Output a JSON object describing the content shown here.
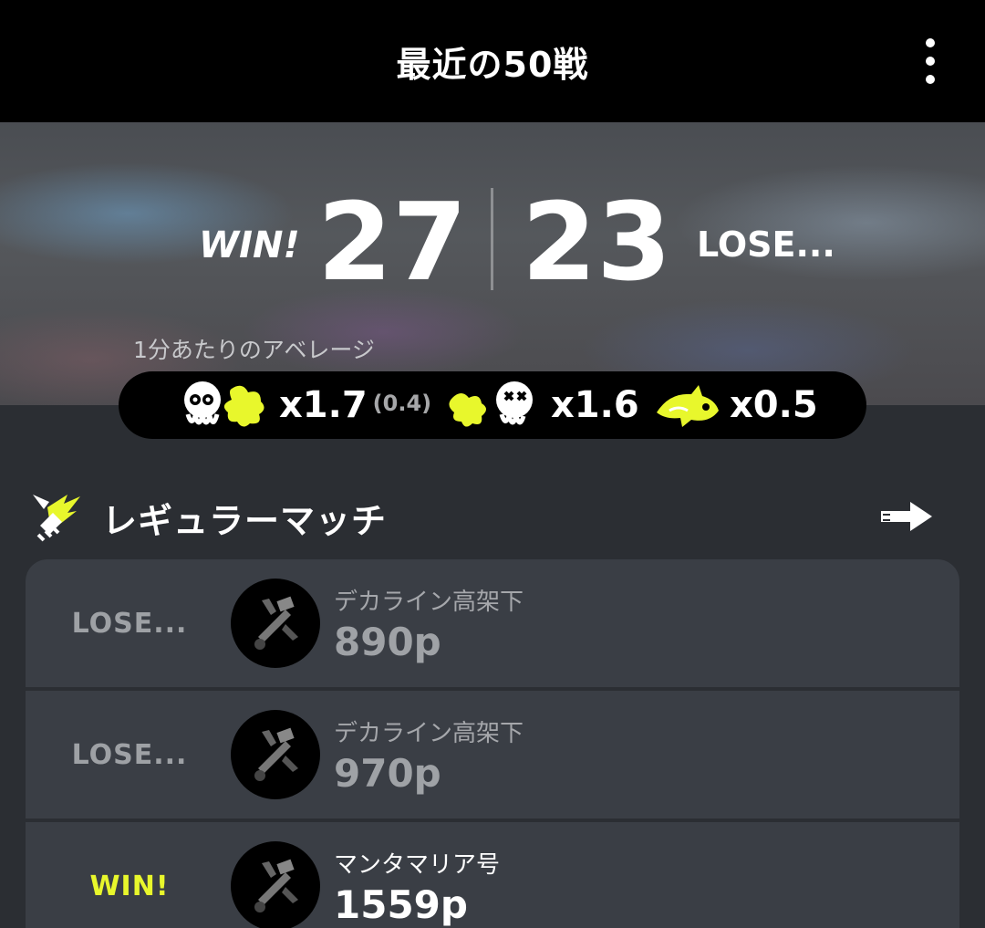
{
  "header": {
    "title": "最近の50戦",
    "menu_icon": "more-vert-icon"
  },
  "summary": {
    "win_label": "WIN!",
    "win_count": "27",
    "lose_count": "23",
    "lose_label": "LOSE...",
    "avg_caption": "1分あたりのアベレージ",
    "stats": [
      {
        "icon": "kill-assist-icon",
        "value": "x1.7",
        "sub": "(0.4)"
      },
      {
        "icon": "death-icon",
        "value": "x1.6"
      },
      {
        "icon": "special-icon",
        "value": "x0.5"
      }
    ]
  },
  "section": {
    "title": "レギュラーマッチ",
    "icon": "regular-match-icon",
    "arrow_icon": "arrow-right-icon"
  },
  "battles": [
    {
      "result": "LOSE...",
      "stage": "デカライン高架下",
      "points": "890p",
      "weapon_icon": "airbrush-weapon-icon"
    },
    {
      "result": "LOSE...",
      "stage": "デカライン高架下",
      "points": "970p",
      "weapon_icon": "airbrush-weapon-icon"
    },
    {
      "result": "WIN!",
      "stage": "マンタマリア号",
      "points": "1559p",
      "weapon_icon": "airbrush-weapon-icon"
    }
  ],
  "colors": {
    "accent": "#e8f72c",
    "background": "#2b2e33",
    "row": "#3a3e45",
    "bar": "#000000"
  }
}
